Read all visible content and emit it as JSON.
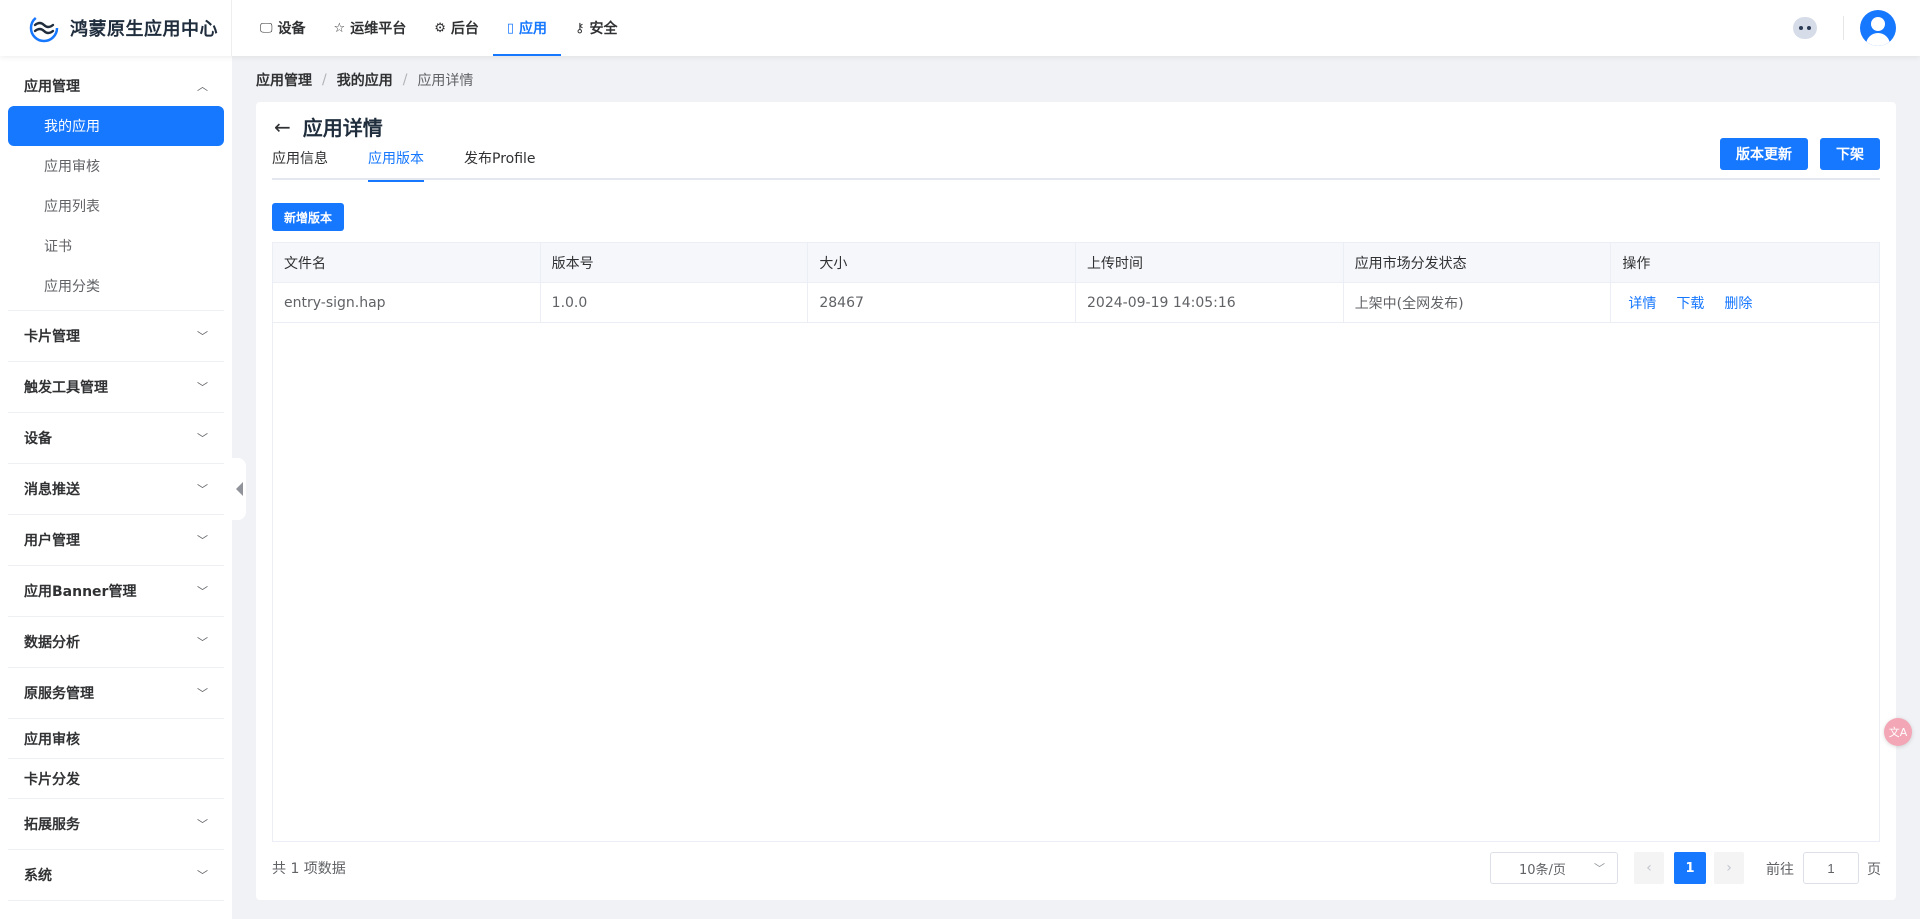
{
  "app": {
    "title": "鸿蒙原生应用中心"
  },
  "topnav": [
    {
      "label": "设备",
      "icon": "monitor-icon",
      "glyph": "🖵"
    },
    {
      "label": "运维平台",
      "icon": "star-icon",
      "glyph": "☆"
    },
    {
      "label": "后台",
      "icon": "gear-icon",
      "glyph": "⚙"
    },
    {
      "label": "应用",
      "icon": "phone-icon",
      "glyph": "▯"
    },
    {
      "label": "安全",
      "icon": "key-icon",
      "glyph": "⚷"
    }
  ],
  "sidebar": {
    "group_app": "应用管理",
    "sub_items": [
      "我的应用",
      "应用审核",
      "应用列表",
      "证书",
      "应用分类"
    ],
    "groups": [
      "卡片管理",
      "触发工具管理",
      "设备",
      "消息推送",
      "用户管理",
      "应用Banner管理",
      "数据分析",
      "原服务管理"
    ],
    "plain": [
      "应用审核",
      "卡片分发"
    ],
    "groups_bottom": [
      "拓展服务",
      "系统"
    ]
  },
  "breadcrumb": [
    "应用管理",
    "我的应用",
    "应用详情"
  ],
  "breadcrumb_sep": "/",
  "page": {
    "title": "应用详情"
  },
  "tabs": [
    "应用信息",
    "应用版本",
    "发布Profile"
  ],
  "buttons": {
    "update": "版本更新",
    "remove": "下架",
    "new_version": "新增版本"
  },
  "table": {
    "headers": [
      "文件名",
      "版本号",
      "大小",
      "上传时间",
      "应用市场分发状态",
      "操作"
    ],
    "rows": [
      {
        "file": "entry-sign.hap",
        "version": "1.0.0",
        "size": "28467",
        "uploaded": "2024-09-19 14:05:16",
        "status": "上架中(全网发布)"
      }
    ],
    "actions": [
      "详情",
      "下载",
      "删除"
    ]
  },
  "pagination": {
    "total": "共 1 项数据",
    "page_size": "10条/页",
    "current_page": "1",
    "goto_label": "前往",
    "goto_value": "1",
    "goto_suffix": "页"
  },
  "translate_label": "文A",
  "colors": {
    "accent": "#1677ff",
    "bg": "#f0f2f5"
  }
}
